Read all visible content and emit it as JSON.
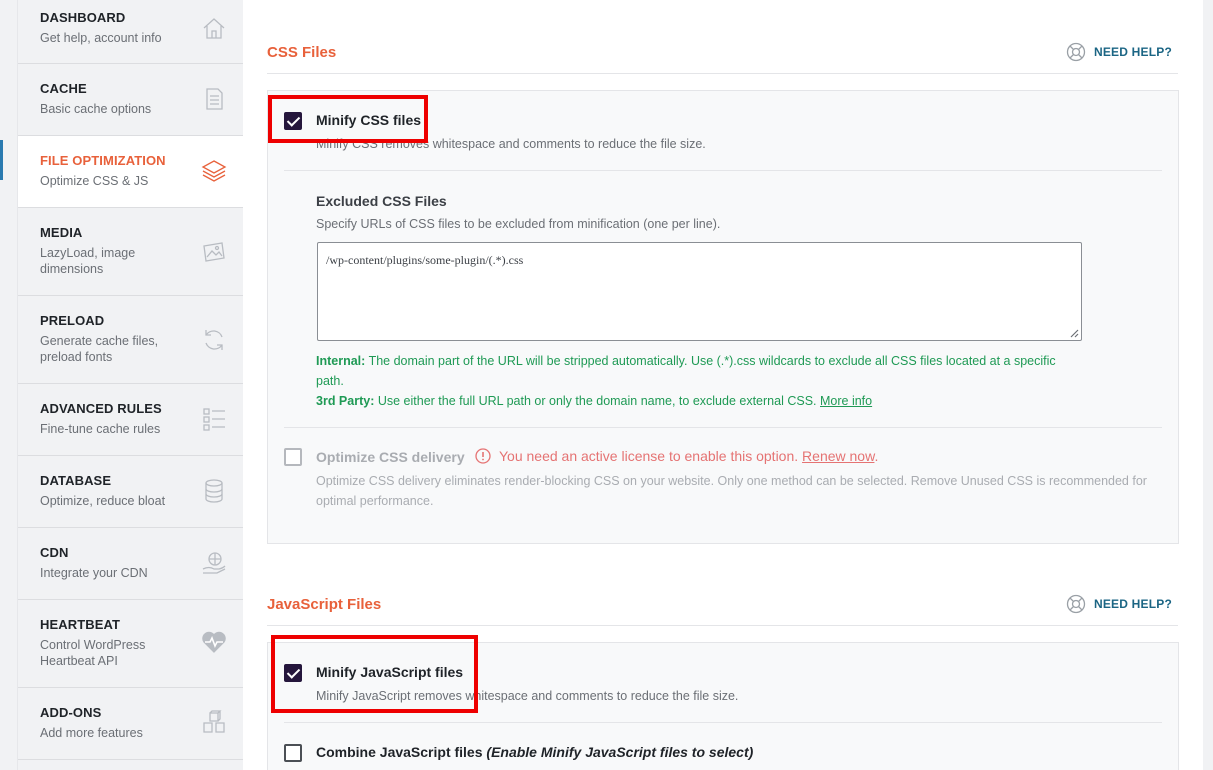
{
  "sidebar": {
    "items": [
      {
        "title": "DASHBOARD",
        "subtitle": "Get help, account info",
        "icon": "home-icon"
      },
      {
        "title": "CACHE",
        "subtitle": "Basic cache options",
        "icon": "document-icon"
      },
      {
        "title": "FILE OPTIMIZATION",
        "subtitle": "Optimize CSS & JS",
        "icon": "layers-icon"
      },
      {
        "title": "MEDIA",
        "subtitle": "LazyLoad, image dimensions",
        "icon": "image-icon"
      },
      {
        "title": "PRELOAD",
        "subtitle": "Generate cache files, preload fonts",
        "icon": "refresh-icon"
      },
      {
        "title": "ADVANCED RULES",
        "subtitle": "Fine-tune cache rules",
        "icon": "list-icon"
      },
      {
        "title": "DATABASE",
        "subtitle": "Optimize, reduce bloat",
        "icon": "database-icon"
      },
      {
        "title": "CDN",
        "subtitle": "Integrate your CDN",
        "icon": "globe-hand-icon"
      },
      {
        "title": "HEARTBEAT",
        "subtitle": "Control WordPress Heartbeat API",
        "icon": "heartbeat-icon"
      },
      {
        "title": "ADD-ONS",
        "subtitle": "Add more features",
        "icon": "cubes-icon"
      }
    ]
  },
  "css": {
    "title": "CSS Files",
    "help": "NEED HELP?",
    "minify_label": "Minify CSS files",
    "minify_desc": "Minify CSS removes whitespace and comments to reduce the file size.",
    "excluded_title": "Excluded CSS Files",
    "excluded_desc": "Specify URLs of CSS files to be excluded from minification (one per line).",
    "excluded_value": "/wp-content/plugins/some-plugin/(.*).css",
    "internal_label": "Internal:",
    "internal_text": "The domain part of the URL will be stripped automatically. Use (.*).css wildcards to exclude all CSS files located at a specific path.",
    "third_label": "3rd Party:",
    "third_text": "Use either the full URL path or only the domain name, to exclude external CSS.",
    "more_info": "More info",
    "optimize_label": "Optimize CSS delivery",
    "license_warning": "You need an active license to enable this option.",
    "renew_link": "Renew now",
    "optimize_desc": "Optimize CSS delivery eliminates render-blocking CSS on your website. Only one method can be selected. Remove Unused CSS is recommended for optimal performance."
  },
  "js": {
    "title": "JavaScript Files",
    "help": "NEED HELP?",
    "minify_label": "Minify JavaScript files",
    "minify_desc": "Minify JavaScript removes whitespace and comments to reduce the file size.",
    "combine_label": "Combine JavaScript files",
    "combine_note": "(Enable Minify JavaScript files to select)"
  },
  "colors": {
    "accent": "#e8613b",
    "help_link": "#1b6584",
    "info_green": "#1f9a55",
    "warning": "#e57373",
    "highlight": "#ee0000"
  }
}
